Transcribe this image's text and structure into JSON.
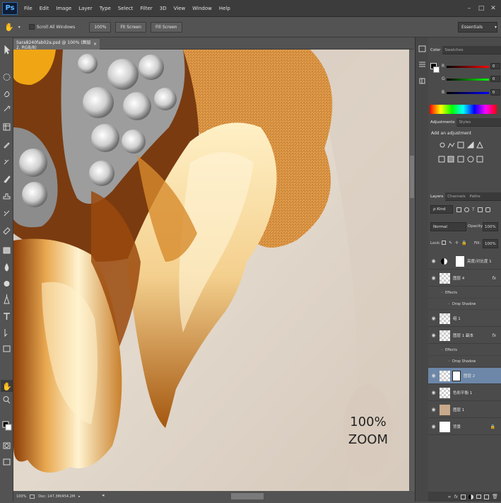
{
  "app": {
    "logo": "Ps"
  },
  "menu": [
    "File",
    "Edit",
    "Image",
    "Layer",
    "Type",
    "Select",
    "Filter",
    "3D",
    "View",
    "Window",
    "Help"
  ],
  "window_controls": [
    "–",
    "□",
    "✕"
  ],
  "options_bar": {
    "tool_icon": "hand-icon",
    "scroll_all_label": "Scroll All Windows",
    "zoom_100_label": "100%",
    "fit_screen_label": "Fit Screen",
    "fill_screen_label": "Fill Screen",
    "workspace": "Essentials"
  },
  "document": {
    "tab_title": "Sara8240fab02a.psd @ 100% (图层 2, RGB/8)",
    "zoom_badge_line1": "100%",
    "zoom_badge_line2": "ZOOM"
  },
  "status": {
    "zoom": "100%",
    "doc": "Doc: 147.3M/454.2M"
  },
  "color_panel": {
    "tabs": [
      "Color",
      "Swatches"
    ],
    "r_label": "R",
    "g_label": "G",
    "b_label": "B",
    "r_value": "0",
    "g_value": "0",
    "b_value": "0"
  },
  "adjustments_panel": {
    "tabs": [
      "Adjustments",
      "Styles"
    ],
    "heading": "Add an adjustment"
  },
  "layers_panel": {
    "tabs": [
      "Layers",
      "Channels",
      "Paths"
    ],
    "kind_label": "ρ Kind",
    "blend_mode": "Normal",
    "opacity_label": "Opacity:",
    "opacity_value": "100%",
    "lock_label": "Lock:",
    "fill_label": "Fill:",
    "fill_value": "100%",
    "layers": [
      {
        "name": "亮度/对比度 1",
        "type": "adjustment"
      },
      {
        "name": "图层 4",
        "type": "layer",
        "fx": "fx"
      },
      {
        "name": "Effects",
        "type": "effect"
      },
      {
        "name": "Drop Shadow",
        "type": "effect"
      },
      {
        "name": "组 1",
        "type": "layer"
      },
      {
        "name": "图层 1 副本",
        "type": "layer",
        "fx": "fx"
      },
      {
        "name": "Effects",
        "type": "effect"
      },
      {
        "name": "Drop Shadow",
        "type": "effect"
      },
      {
        "name": "图层 2",
        "type": "layer-selected"
      },
      {
        "name": "色彩平衡 1",
        "type": "layer"
      },
      {
        "name": "图层 1",
        "type": "layer"
      },
      {
        "name": "背景",
        "type": "background"
      }
    ]
  },
  "colors": {
    "accent_selected": "#6d87a8",
    "panel_bg": "#4b4b4b"
  }
}
